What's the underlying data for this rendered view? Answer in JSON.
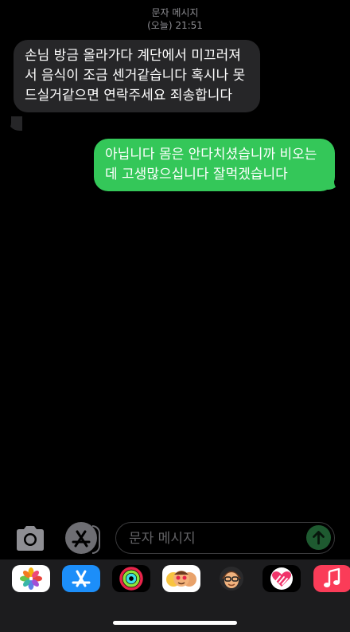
{
  "header": {
    "title": "문자 메시지",
    "timestamp": "(오늘) 21:51"
  },
  "messages": [
    {
      "direction": "incoming",
      "text": "손님 방금 올라가다 계단에서 미끄러져서 음식이 조금 센거같습니다 혹시나 못드실거같으면 연락주세요 죄송합니다"
    },
    {
      "direction": "outgoing",
      "text": "아닙니다 몸은 안다치셨습니까 비오는데 고생많으십니다 잘먹겠습니다"
    }
  ],
  "composer": {
    "placeholder": "문자 메시지",
    "value": ""
  },
  "colors": {
    "incoming_bubble": "#262628",
    "outgoing_bubble": "#34c759",
    "background": "#000000"
  },
  "app_drawer": [
    {
      "icon": "photos-icon"
    },
    {
      "icon": "app-store-icon"
    },
    {
      "icon": "activity-icon"
    },
    {
      "icon": "memoji-icon"
    },
    {
      "icon": "memoji-stickers-icon"
    },
    {
      "icon": "digital-touch-icon"
    },
    {
      "icon": "music-icon"
    }
  ]
}
